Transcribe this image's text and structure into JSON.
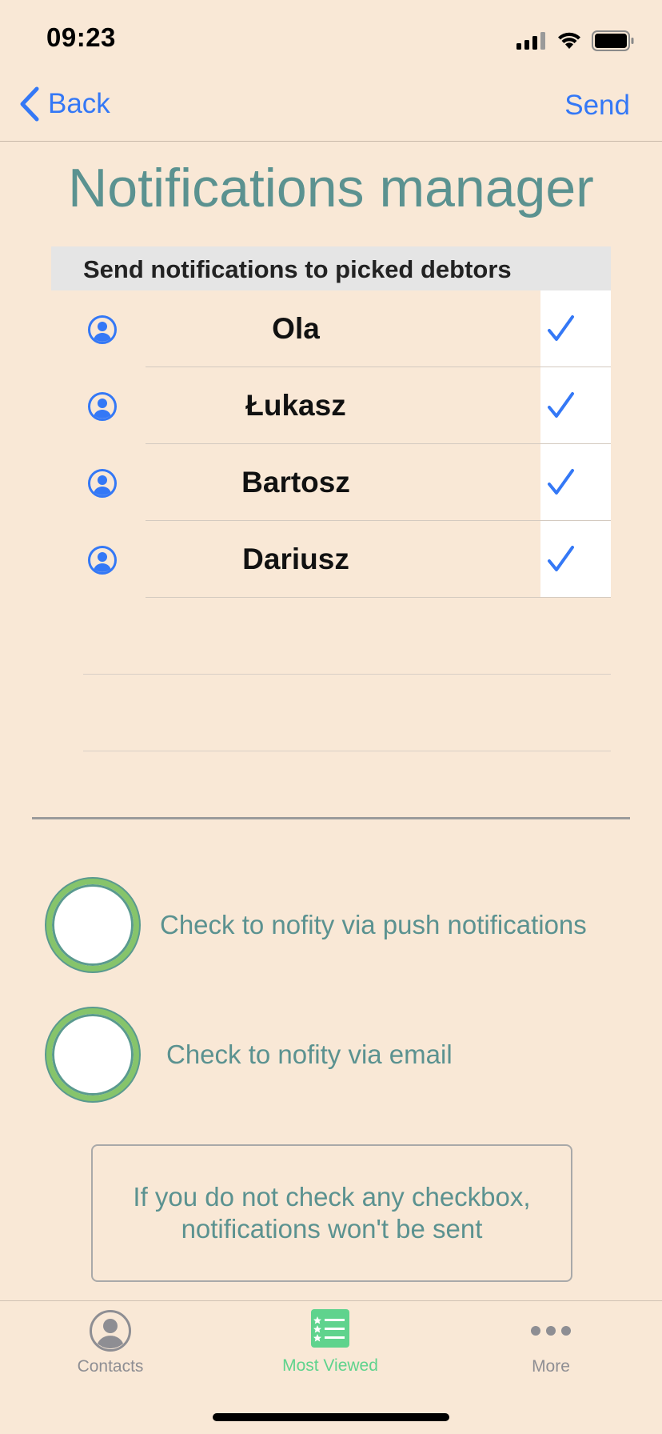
{
  "status_bar": {
    "time": "09:23"
  },
  "nav": {
    "back_label": "Back",
    "send_label": "Send"
  },
  "title": "Notifications manager",
  "section_header": "Send notifications to picked debtors",
  "debtors": [
    {
      "name": "Ola",
      "checked": true
    },
    {
      "name": "Łukasz",
      "checked": true
    },
    {
      "name": "Bartosz",
      "checked": true
    },
    {
      "name": "Dariusz",
      "checked": true
    }
  ],
  "options": {
    "push_label": "Check to nofity via push notifications",
    "email_label": "Check to nofity via email"
  },
  "info_lines": [
    "If you do not check any checkbox,",
    "notifications won't be sent"
  ],
  "tabs": [
    {
      "label": "Contacts",
      "icon": "contacts-icon"
    },
    {
      "label": "Most Viewed",
      "icon": "most-viewed-icon",
      "active": true
    },
    {
      "label": "More",
      "icon": "more-icon"
    }
  ],
  "colors": {
    "background": "#f9e8d6",
    "accent_blue": "#3478f6",
    "teal_text": "#5b9290",
    "tab_active": "#5fd38d",
    "tab_inactive": "#8e8e93"
  }
}
